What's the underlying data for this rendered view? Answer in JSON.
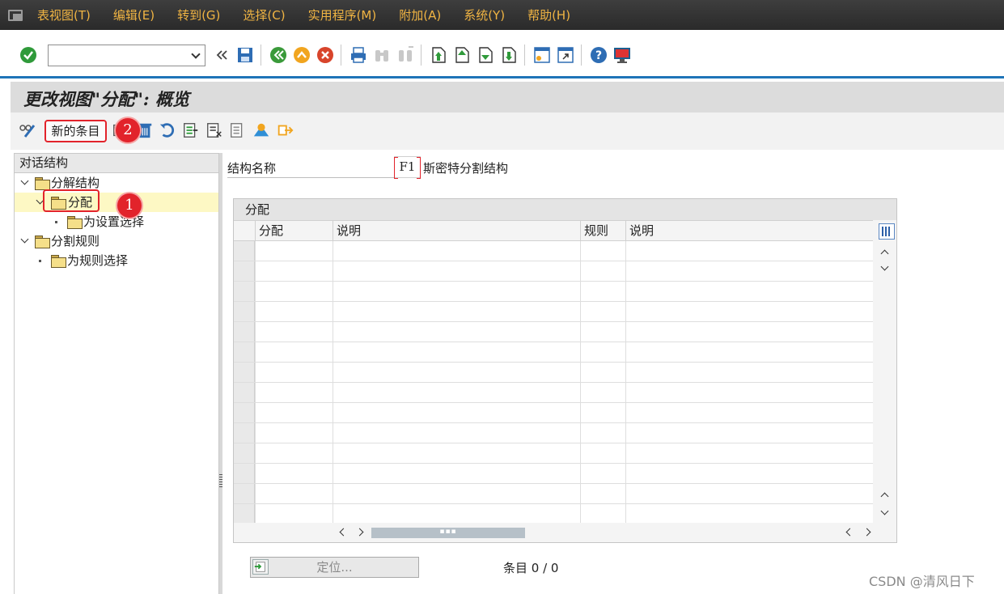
{
  "menubar": {
    "items": [
      "表视图(T)",
      "编辑(E)",
      "转到(G)",
      "选择(C)",
      "实用程序(M)",
      "附加(A)",
      "系统(Y)",
      "帮助(H)"
    ]
  },
  "toolbar": {
    "command_field_value": "",
    "icons": [
      "enter-icon",
      "back-icon",
      "save-icon",
      "back-green-icon",
      "exit-icon",
      "cancel-icon",
      "print-icon",
      "find-icon",
      "find-next-icon",
      "first-page-icon",
      "prev-page-icon",
      "next-page-icon",
      "last-page-icon",
      "new-session-icon",
      "shortcut-icon",
      "help-icon",
      "layout-icon"
    ]
  },
  "title": "更改视图\"分配\": 概览",
  "app_toolbar": {
    "new_entry_label": "新的条目"
  },
  "tree": {
    "header": "对话结构",
    "nodes": [
      {
        "label": "分解结构",
        "level": 0,
        "expanded": true
      },
      {
        "label": "分配",
        "level": 1,
        "expanded": true,
        "selected": true
      },
      {
        "label": "为设置选择",
        "level": 2
      },
      {
        "label": "分割规则",
        "level": 0,
        "expanded": true
      },
      {
        "label": "为规则选择",
        "level": 1
      }
    ]
  },
  "structure": {
    "label": "结构名称",
    "value": "F1",
    "description": "斯密特分割结构"
  },
  "grid": {
    "title": "分配",
    "columns": [
      "分配",
      "说明",
      "规则",
      "说明"
    ],
    "row_count": 14
  },
  "locate_button_label": "定位...",
  "entry_count": "条目 0 / 0",
  "watermark": "CSDN @清风日下",
  "annotations": {
    "badge1": "1",
    "badge2": "2"
  },
  "colors": {
    "menu_text": "#f0b443",
    "accent_blue": "#1e74b8",
    "annotation_red": "#e2232b",
    "selection_yellow": "#fdf8c4"
  }
}
